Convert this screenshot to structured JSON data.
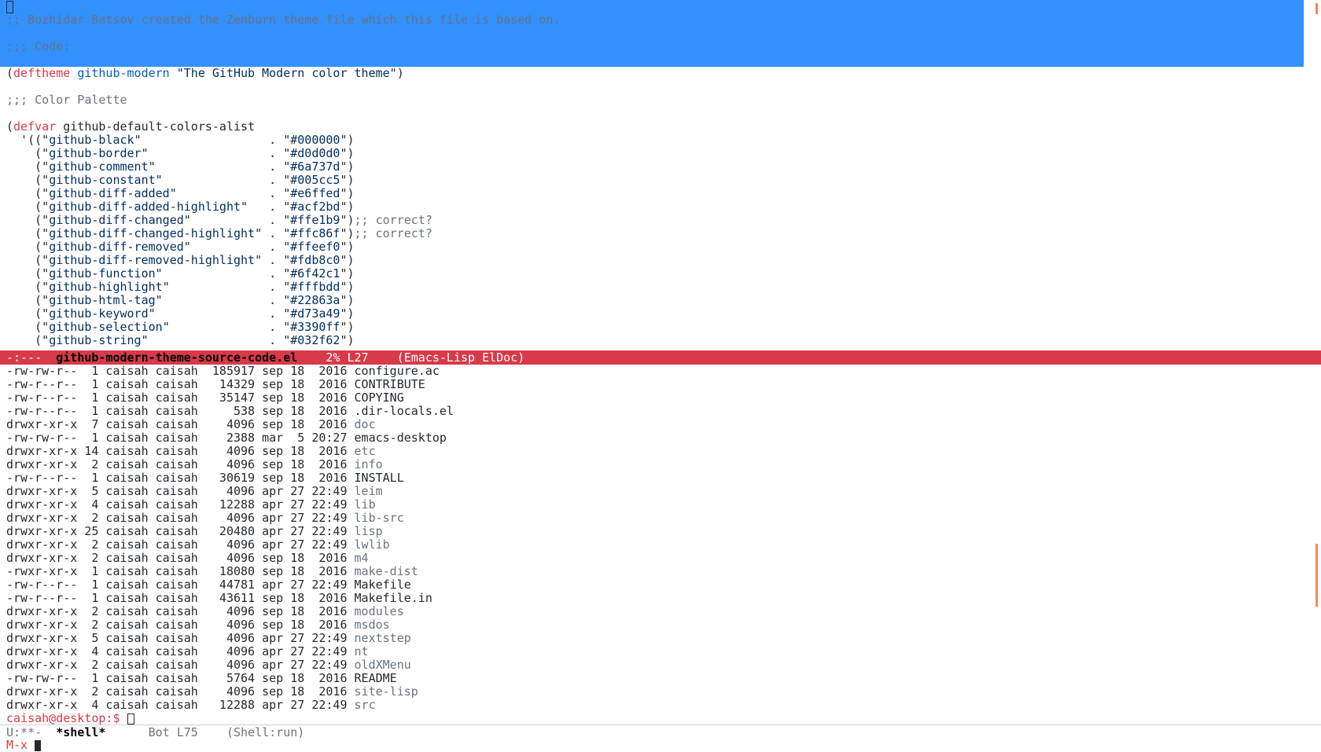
{
  "editor": {
    "selected_lines": [
      "",
      ";; Bozhidar Batsov created the Zenburn theme file which this file is based on.",
      "",
      ";;; Code:",
      ""
    ],
    "deftheme": {
      "keyword": "deftheme",
      "name": "github-modern",
      "doc": "\"The GitHub Modern color theme\""
    },
    "palette_comment": ";;; Color Palette",
    "defvar": {
      "keyword": "defvar",
      "name": "github-default-colors-alist"
    },
    "colors": [
      {
        "name": "github-black",
        "value": "#000000",
        "comment": ""
      },
      {
        "name": "github-border",
        "value": "#d0d0d0",
        "comment": ""
      },
      {
        "name": "github-comment",
        "value": "#6a737d",
        "comment": ""
      },
      {
        "name": "github-constant",
        "value": "#005cc5",
        "comment": ""
      },
      {
        "name": "github-diff-added",
        "value": "#e6ffed",
        "comment": ""
      },
      {
        "name": "github-diff-added-highlight",
        "value": "#acf2bd",
        "comment": ""
      },
      {
        "name": "github-diff-changed",
        "value": "#ffe1b9",
        "comment": ";; correct?"
      },
      {
        "name": "github-diff-changed-highlight",
        "value": "#ffc86f",
        "comment": ";; correct?"
      },
      {
        "name": "github-diff-removed",
        "value": "#ffeef0",
        "comment": ""
      },
      {
        "name": "github-diff-removed-highlight",
        "value": "#fdb8c0",
        "comment": ""
      },
      {
        "name": "github-function",
        "value": "#6f42c1",
        "comment": ""
      },
      {
        "name": "github-highlight",
        "value": "#fffbdd",
        "comment": ""
      },
      {
        "name": "github-html-tag",
        "value": "#22863a",
        "comment": ""
      },
      {
        "name": "github-keyword",
        "value": "#d73a49",
        "comment": ""
      },
      {
        "name": "github-selection",
        "value": "#3390ff",
        "comment": ""
      },
      {
        "name": "github-string",
        "value": "#032f62",
        "comment": ""
      }
    ]
  },
  "modeline_top": {
    "status": "-:---",
    "buffer": "github-modern-theme-source-code.el",
    "position": "2% L27",
    "modes": "(Emacs-Lisp ElDoc)"
  },
  "shell": {
    "listing": [
      {
        "perm": "-rw-rw-r--",
        "links": "1",
        "owner": "caisah",
        "group": "caisah",
        "size": "185917",
        "month": "sep",
        "day": "18",
        "time": "2016",
        "name": "configure.ac",
        "dir": false
      },
      {
        "perm": "-rw-r--r--",
        "links": "1",
        "owner": "caisah",
        "group": "caisah",
        "size": "14329",
        "month": "sep",
        "day": "18",
        "time": "2016",
        "name": "CONTRIBUTE",
        "dir": false
      },
      {
        "perm": "-rw-r--r--",
        "links": "1",
        "owner": "caisah",
        "group": "caisah",
        "size": "35147",
        "month": "sep",
        "day": "18",
        "time": "2016",
        "name": "COPYING",
        "dir": false
      },
      {
        "perm": "-rw-r--r--",
        "links": "1",
        "owner": "caisah",
        "group": "caisah",
        "size": "538",
        "month": "sep",
        "day": "18",
        "time": "2016",
        "name": ".dir-locals.el",
        "dir": false
      },
      {
        "perm": "drwxr-xr-x",
        "links": "7",
        "owner": "caisah",
        "group": "caisah",
        "size": "4096",
        "month": "sep",
        "day": "18",
        "time": "2016",
        "name": "doc",
        "dir": true
      },
      {
        "perm": "-rw-rw-r--",
        "links": "1",
        "owner": "caisah",
        "group": "caisah",
        "size": "2388",
        "month": "mar",
        "day": "5",
        "time": "20:27",
        "name": "emacs-desktop",
        "dir": false
      },
      {
        "perm": "drwxr-xr-x",
        "links": "14",
        "owner": "caisah",
        "group": "caisah",
        "size": "4096",
        "month": "sep",
        "day": "18",
        "time": "2016",
        "name": "etc",
        "dir": true
      },
      {
        "perm": "drwxr-xr-x",
        "links": "2",
        "owner": "caisah",
        "group": "caisah",
        "size": "4096",
        "month": "sep",
        "day": "18",
        "time": "2016",
        "name": "info",
        "dir": true
      },
      {
        "perm": "-rw-r--r--",
        "links": "1",
        "owner": "caisah",
        "group": "caisah",
        "size": "30619",
        "month": "sep",
        "day": "18",
        "time": "2016",
        "name": "INSTALL",
        "dir": false
      },
      {
        "perm": "drwxr-xr-x",
        "links": "5",
        "owner": "caisah",
        "group": "caisah",
        "size": "4096",
        "month": "apr",
        "day": "27",
        "time": "22:49",
        "name": "leim",
        "dir": true
      },
      {
        "perm": "drwxr-xr-x",
        "links": "4",
        "owner": "caisah",
        "group": "caisah",
        "size": "12288",
        "month": "apr",
        "day": "27",
        "time": "22:49",
        "name": "lib",
        "dir": true
      },
      {
        "perm": "drwxr-xr-x",
        "links": "2",
        "owner": "caisah",
        "group": "caisah",
        "size": "4096",
        "month": "apr",
        "day": "27",
        "time": "22:49",
        "name": "lib-src",
        "dir": true
      },
      {
        "perm": "drwxr-xr-x",
        "links": "25",
        "owner": "caisah",
        "group": "caisah",
        "size": "20480",
        "month": "apr",
        "day": "27",
        "time": "22:49",
        "name": "lisp",
        "dir": true
      },
      {
        "perm": "drwxr-xr-x",
        "links": "2",
        "owner": "caisah",
        "group": "caisah",
        "size": "4096",
        "month": "apr",
        "day": "27",
        "time": "22:49",
        "name": "lwlib",
        "dir": true
      },
      {
        "perm": "drwxr-xr-x",
        "links": "2",
        "owner": "caisah",
        "group": "caisah",
        "size": "4096",
        "month": "sep",
        "day": "18",
        "time": "2016",
        "name": "m4",
        "dir": true
      },
      {
        "perm": "-rwxr-xr-x",
        "links": "1",
        "owner": "caisah",
        "group": "caisah",
        "size": "18080",
        "month": "sep",
        "day": "18",
        "time": "2016",
        "name": "make-dist",
        "dir": true
      },
      {
        "perm": "-rw-r--r--",
        "links": "1",
        "owner": "caisah",
        "group": "caisah",
        "size": "44781",
        "month": "apr",
        "day": "27",
        "time": "22:49",
        "name": "Makefile",
        "dir": false
      },
      {
        "perm": "-rw-r--r--",
        "links": "1",
        "owner": "caisah",
        "group": "caisah",
        "size": "43611",
        "month": "sep",
        "day": "18",
        "time": "2016",
        "name": "Makefile.in",
        "dir": false
      },
      {
        "perm": "drwxr-xr-x",
        "links": "2",
        "owner": "caisah",
        "group": "caisah",
        "size": "4096",
        "month": "sep",
        "day": "18",
        "time": "2016",
        "name": "modules",
        "dir": true
      },
      {
        "perm": "drwxr-xr-x",
        "links": "2",
        "owner": "caisah",
        "group": "caisah",
        "size": "4096",
        "month": "sep",
        "day": "18",
        "time": "2016",
        "name": "msdos",
        "dir": true
      },
      {
        "perm": "drwxr-xr-x",
        "links": "5",
        "owner": "caisah",
        "group": "caisah",
        "size": "4096",
        "month": "apr",
        "day": "27",
        "time": "22:49",
        "name": "nextstep",
        "dir": true
      },
      {
        "perm": "drwxr-xr-x",
        "links": "4",
        "owner": "caisah",
        "group": "caisah",
        "size": "4096",
        "month": "apr",
        "day": "27",
        "time": "22:49",
        "name": "nt",
        "dir": true
      },
      {
        "perm": "drwxr-xr-x",
        "links": "2",
        "owner": "caisah",
        "group": "caisah",
        "size": "4096",
        "month": "apr",
        "day": "27",
        "time": "22:49",
        "name": "oldXMenu",
        "dir": true
      },
      {
        "perm": "-rw-rw-r--",
        "links": "1",
        "owner": "caisah",
        "group": "caisah",
        "size": "5764",
        "month": "sep",
        "day": "18",
        "time": "2016",
        "name": "README",
        "dir": false
      },
      {
        "perm": "drwxr-xr-x",
        "links": "2",
        "owner": "caisah",
        "group": "caisah",
        "size": "4096",
        "month": "sep",
        "day": "18",
        "time": "2016",
        "name": "site-lisp",
        "dir": true
      },
      {
        "perm": "drwxr-xr-x",
        "links": "4",
        "owner": "caisah",
        "group": "caisah",
        "size": "12288",
        "month": "apr",
        "day": "27",
        "time": "22:49",
        "name": "src",
        "dir": true
      }
    ],
    "prompt": "caisah@desktop:$ "
  },
  "modeline_bottom": {
    "status": "U:**-",
    "buffer": "*shell*",
    "position": "Bot L75",
    "modes": "(Shell:run)"
  },
  "minibuffer": {
    "prompt": "M-x "
  },
  "colors": {
    "selection": "#3390ff",
    "modeline_active": "#d73a49",
    "keyword": "#d73a49",
    "function": "#005cc5",
    "comment": "#6a737d",
    "string": "#032f62"
  }
}
